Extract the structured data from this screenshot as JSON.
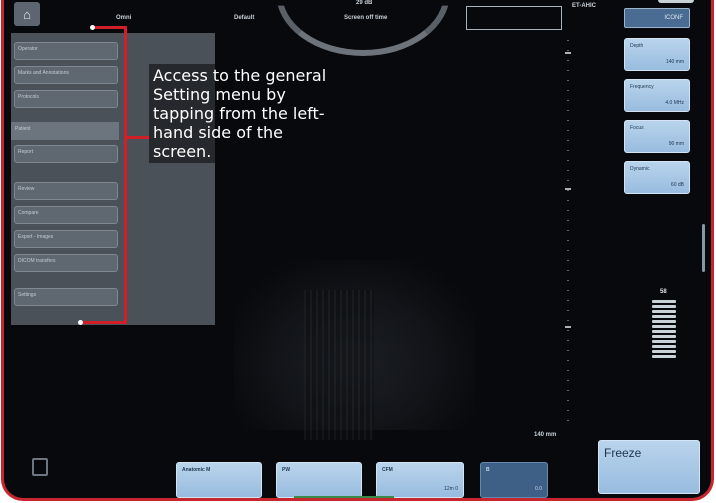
{
  "top_bar": {
    "left_label": "Omni",
    "default_label": "Default",
    "center_top": "29 dB",
    "center_label": "Screen off time",
    "right_text": "ET-AHIC",
    "right_button": "ICONF"
  },
  "right_panel": {
    "params": [
      {
        "name": "Depth",
        "value": "140 mm"
      },
      {
        "name": "Frequency",
        "value": "4.0 MHz"
      },
      {
        "name": "Focus",
        "value": "90 mm"
      },
      {
        "name": "Dynamic",
        "value": "60 dB"
      }
    ],
    "gain_label": "58",
    "freeze_label": "Freeze"
  },
  "depth_label": "140 mm",
  "bottom_bar": {
    "buttons": [
      {
        "name": "Anatomic M",
        "value": ""
      },
      {
        "name": "PW",
        "value": ""
      },
      {
        "name": "CFM",
        "value": "12m 0"
      },
      {
        "name": "B",
        "value": "0.0"
      }
    ]
  },
  "left_menu": {
    "items": [
      {
        "label": "Operator"
      },
      {
        "label": "Marks and Annotations"
      },
      {
        "label": "Protocols"
      },
      {
        "label": "Patient"
      },
      {
        "label": "Report"
      },
      {
        "label": "Review"
      },
      {
        "label": "Compare"
      },
      {
        "label": "Export - Images"
      },
      {
        "label": "DICOM transfers"
      },
      {
        "label": "Settings"
      }
    ]
  },
  "annotation": {
    "text": "Access to the general Setting menu by tapping from the left-hand side of the screen."
  },
  "colors": {
    "accent_red": "#d11f27",
    "button_blue": "#98bcdf",
    "screen_bg": "#07090d"
  }
}
